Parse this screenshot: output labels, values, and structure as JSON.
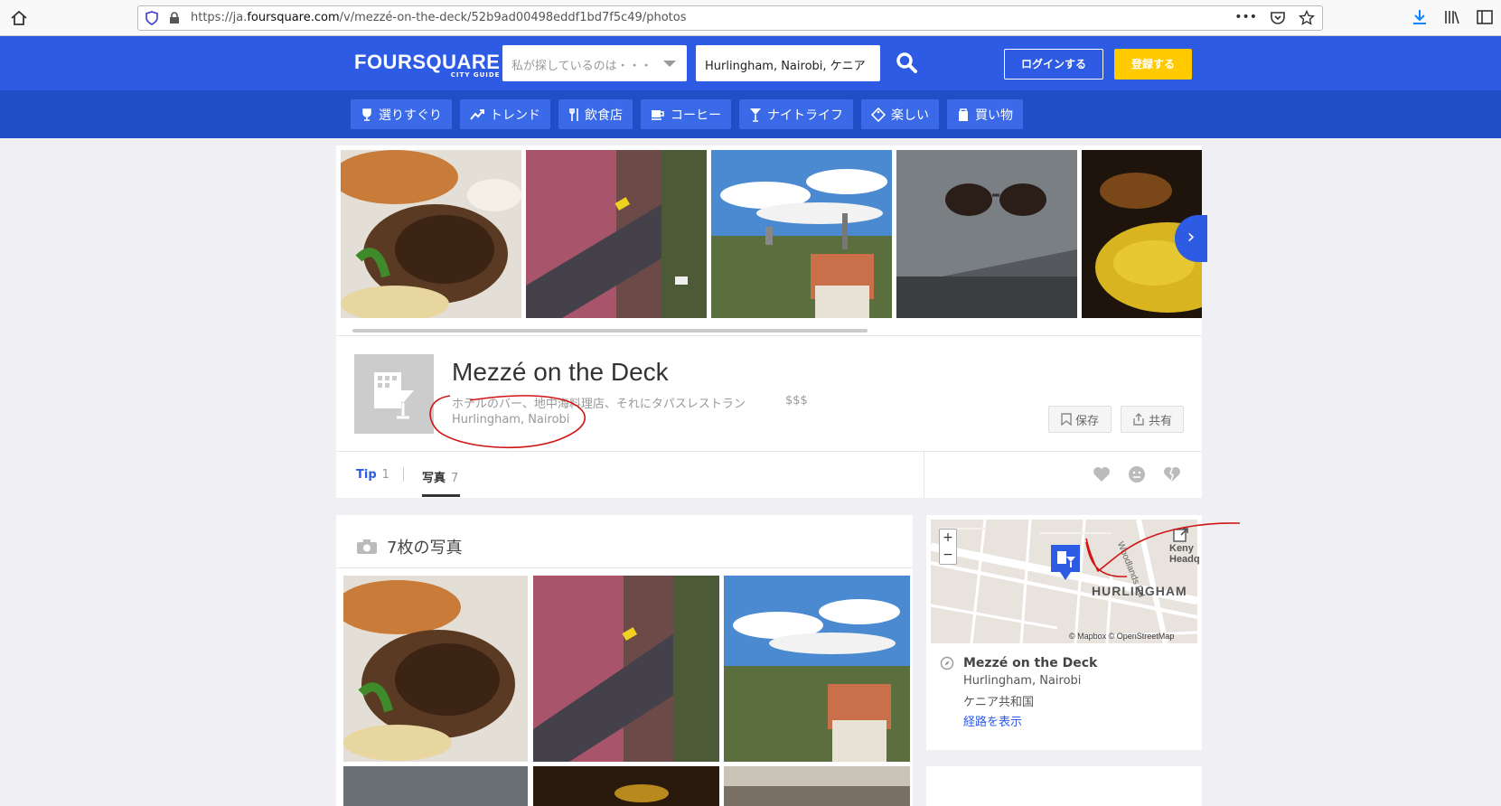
{
  "browser": {
    "url_prefix": "https://ja.",
    "url_domain": "foursquare.com",
    "url_path": "/v/mezzé-on-the-deck/52b9ad00498eddf1bd7f5c49/photos"
  },
  "header": {
    "logo": "FOURSQUARE",
    "logo_sub": "CITY GUIDE",
    "search_what_placeholder": "私が探しているのは・・・",
    "search_where_value": "Hurlingham, Nairobi, ケニア",
    "login_label": "ログインする",
    "signup_label": "登録する",
    "brand_color": "#2d5be3",
    "signup_color": "#ffca00"
  },
  "nav": {
    "items": [
      {
        "label": "選りすぐり",
        "icon": "trophy-icon"
      },
      {
        "label": "トレンド",
        "icon": "trending-icon"
      },
      {
        "label": "飲食店",
        "icon": "fork-knife-icon"
      },
      {
        "label": "コーヒー",
        "icon": "coffee-icon"
      },
      {
        "label": "ナイトライフ",
        "icon": "cocktail-icon"
      },
      {
        "label": "楽しい",
        "icon": "ticket-icon"
      },
      {
        "label": "買い物",
        "icon": "shopping-bag-icon"
      }
    ]
  },
  "venue": {
    "name": "Mezzé on the Deck",
    "categories": "ホテルのバー、地中海料理店、それにタパスレストラン",
    "price": "$$$",
    "location": "Hurlingham, Nairobi",
    "save_label": "保存",
    "share_label": "共有"
  },
  "tabs": {
    "tip_label": "Tip",
    "tip_count": "1",
    "photos_label": "写真",
    "photos_count": "7"
  },
  "photos": {
    "heading": "7枚の写真"
  },
  "map": {
    "zoom_in": "+",
    "zoom_out": "−",
    "label_area": "HURLINGHAM",
    "label_keny_1": "Keny",
    "label_keny_2": "Headq",
    "label_road": "Woodlands Rd",
    "credit": "© Mapbox © OpenStreetMap",
    "venue_name": "Mezzé on the Deck",
    "venue_area": "Hurlingham, Nairobi",
    "venue_country": "ケニア共和国",
    "directions_label": "経路を表示"
  }
}
